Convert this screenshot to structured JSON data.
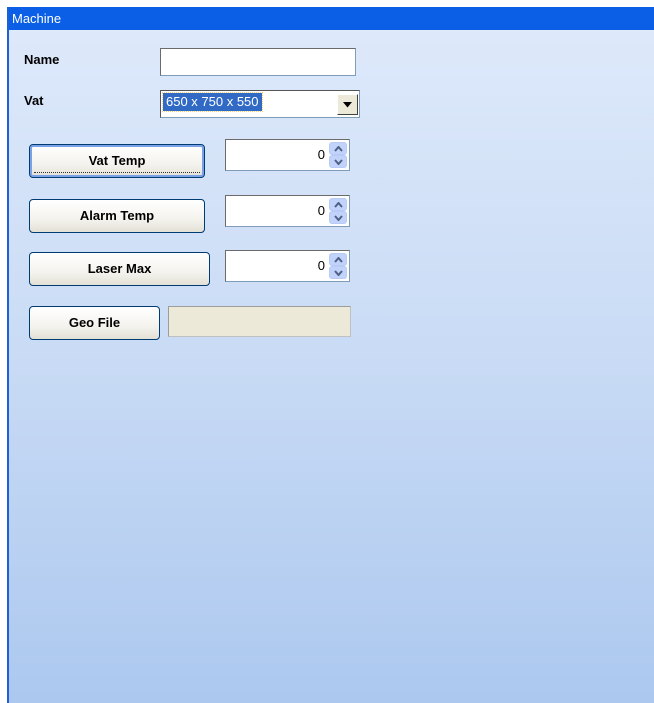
{
  "window": {
    "title": "Machine"
  },
  "form": {
    "name_label": "Name",
    "name_value": "",
    "vat_label": "Vat",
    "vat_selected": "650 x 750 x 550",
    "vat_temp_label": "Vat Temp",
    "vat_temp_value": "0",
    "alarm_temp_label": "Alarm Temp",
    "alarm_temp_value": "0",
    "laser_max_label": "Laser Max",
    "laser_max_value": "0",
    "geo_file_label": "Geo File",
    "geo_file_value": ""
  },
  "colors": {
    "titlebar": "#0a5fe6",
    "panel_top": "#dfeafb",
    "panel_bottom": "#acc8ef",
    "selection": "#316ac5"
  },
  "icons": {
    "combo_arrow": "chevron-down-icon",
    "spinner_up": "spinner-up-icon",
    "spinner_down": "spinner-down-icon"
  }
}
